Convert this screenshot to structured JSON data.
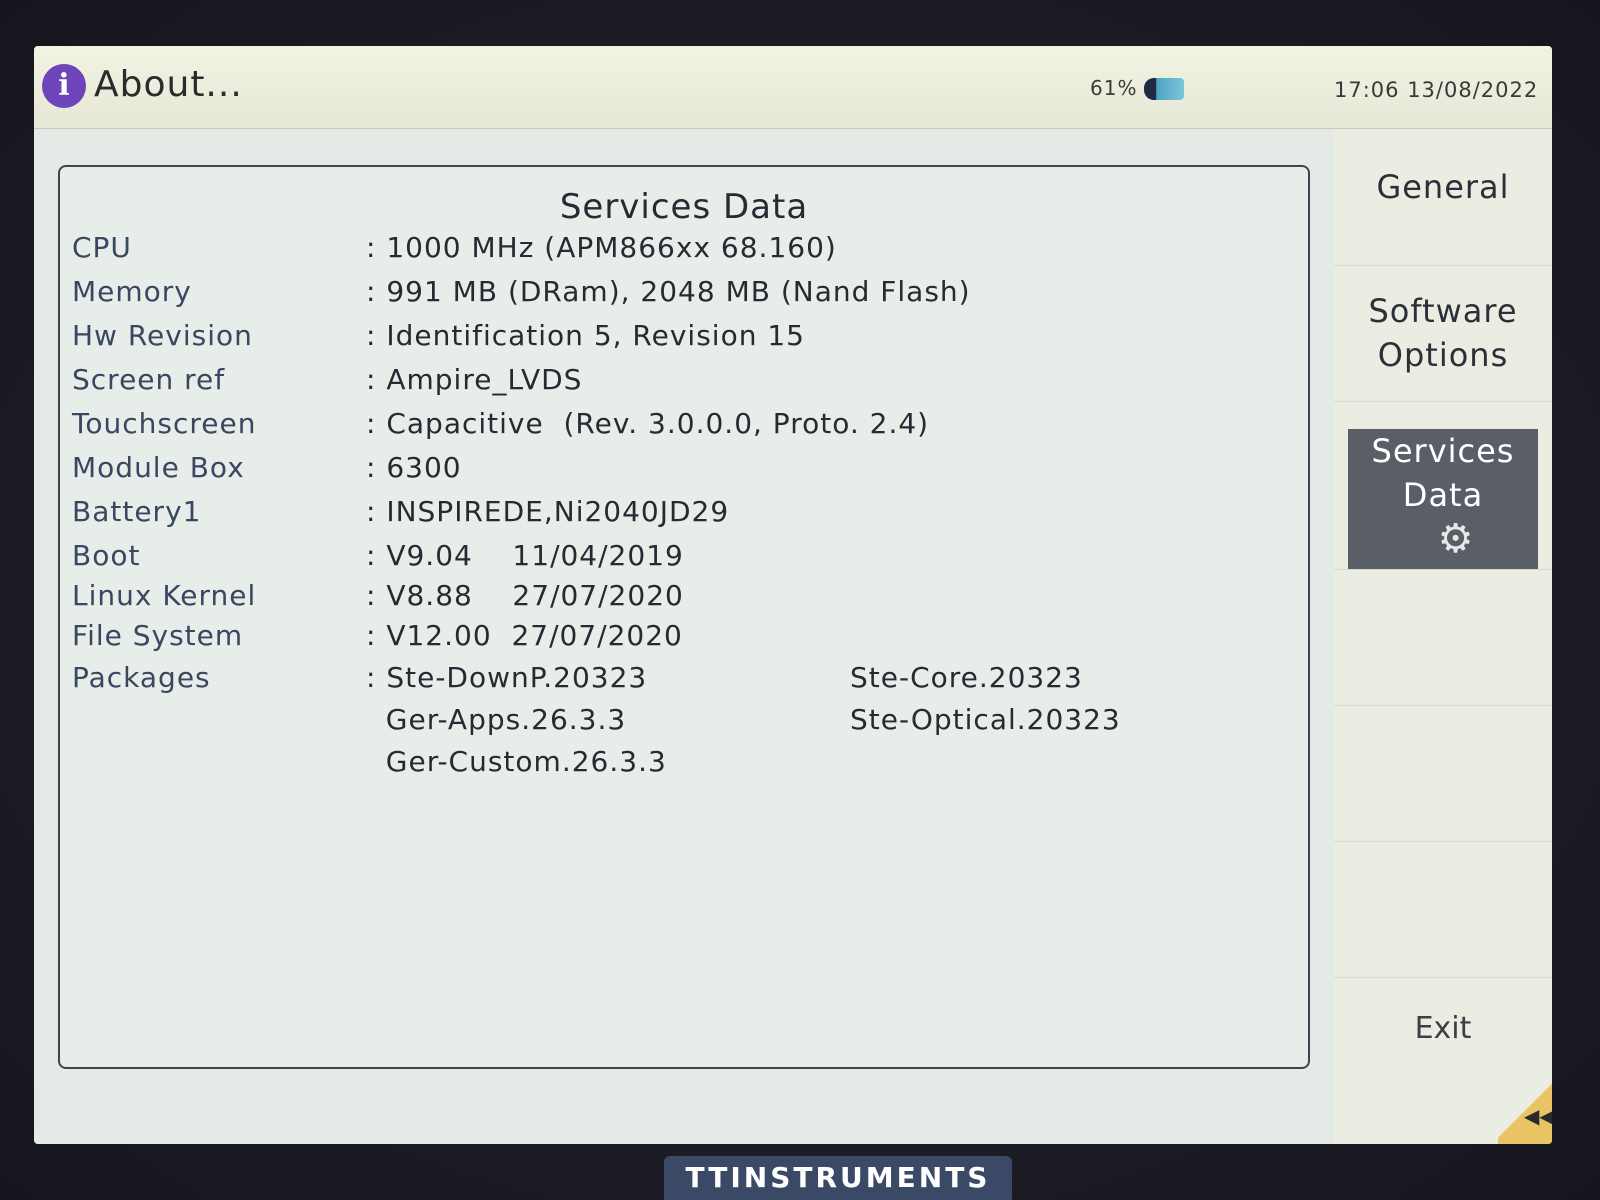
{
  "titlebar": {
    "title": "About...",
    "battery": "61%",
    "clock": "17:06  13/08/2022",
    "icon": "info-icon"
  },
  "panel": {
    "title": "Services Data",
    "rows": [
      {
        "label": "CPU",
        "value": ": 1000 MHz (APM866xx 68.160)"
      },
      {
        "label": "Memory",
        "value": ": 991 MB (DRam), 2048 MB (Nand Flash)"
      },
      {
        "label": "Hw Revision",
        "value": ": Identification 5, Revision 15"
      },
      {
        "label": "Screen ref",
        "value": ": Ampire_LVDS"
      },
      {
        "label": "Touchscreen",
        "value": ": Capacitive  (Rev. 3.0.0.0, Proto. 2.4)"
      },
      {
        "label": "Module Box",
        "value": ": 6300"
      },
      {
        "label": "Battery1",
        "value": ": INSPIREDE,Ni2040JD29"
      },
      {
        "label": "Boot",
        "value": ": V9.04    11/04/2019"
      },
      {
        "label": "Linux Kernel",
        "value": ": V8.88    27/07/2020"
      },
      {
        "label": "File System",
        "value": ": V12.00  27/07/2020"
      }
    ],
    "packages": {
      "label": "Packages",
      "col1": [
        ": Ste-DownP.20323",
        "  Ger-Apps.26.3.3",
        "  Ger-Custom.26.3.3"
      ],
      "col2": [
        "Ste-Core.20323",
        "Ste-Optical.20323"
      ]
    }
  },
  "sidemenu": {
    "items": [
      {
        "label": "General"
      },
      {
        "label": "Software\nOptions"
      },
      {
        "label": "Services\nData",
        "icon": "gear-icon"
      }
    ],
    "exit": "Exit"
  },
  "brand": "TTINSTRUMENTS"
}
